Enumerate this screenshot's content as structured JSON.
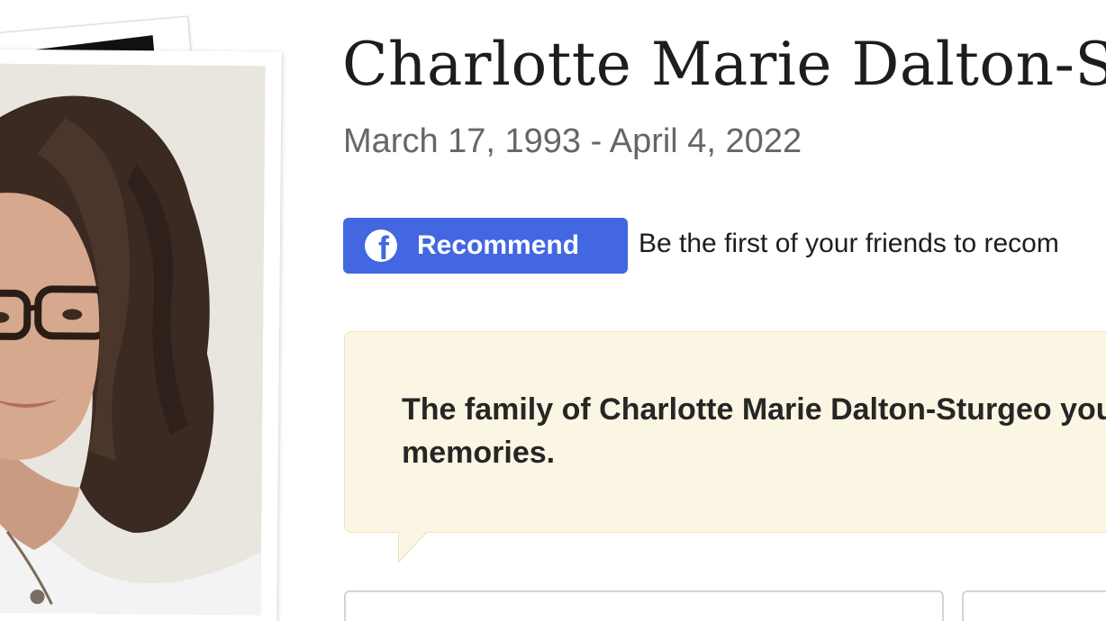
{
  "obituary": {
    "name": "Charlotte Marie Dalton-St",
    "dates": "March 17, 1993 - April 4, 2022"
  },
  "recommend": {
    "icon": "facebook-icon",
    "icon_glyph": "f",
    "button_label": "Recommend",
    "prompt": "Be the first of your friends to recom",
    "accent_color": "#4267e0"
  },
  "memories": {
    "message": "The family of Charlotte Marie Dalton-Sturgeo your memories.",
    "background_color": "#fbf6e3"
  }
}
